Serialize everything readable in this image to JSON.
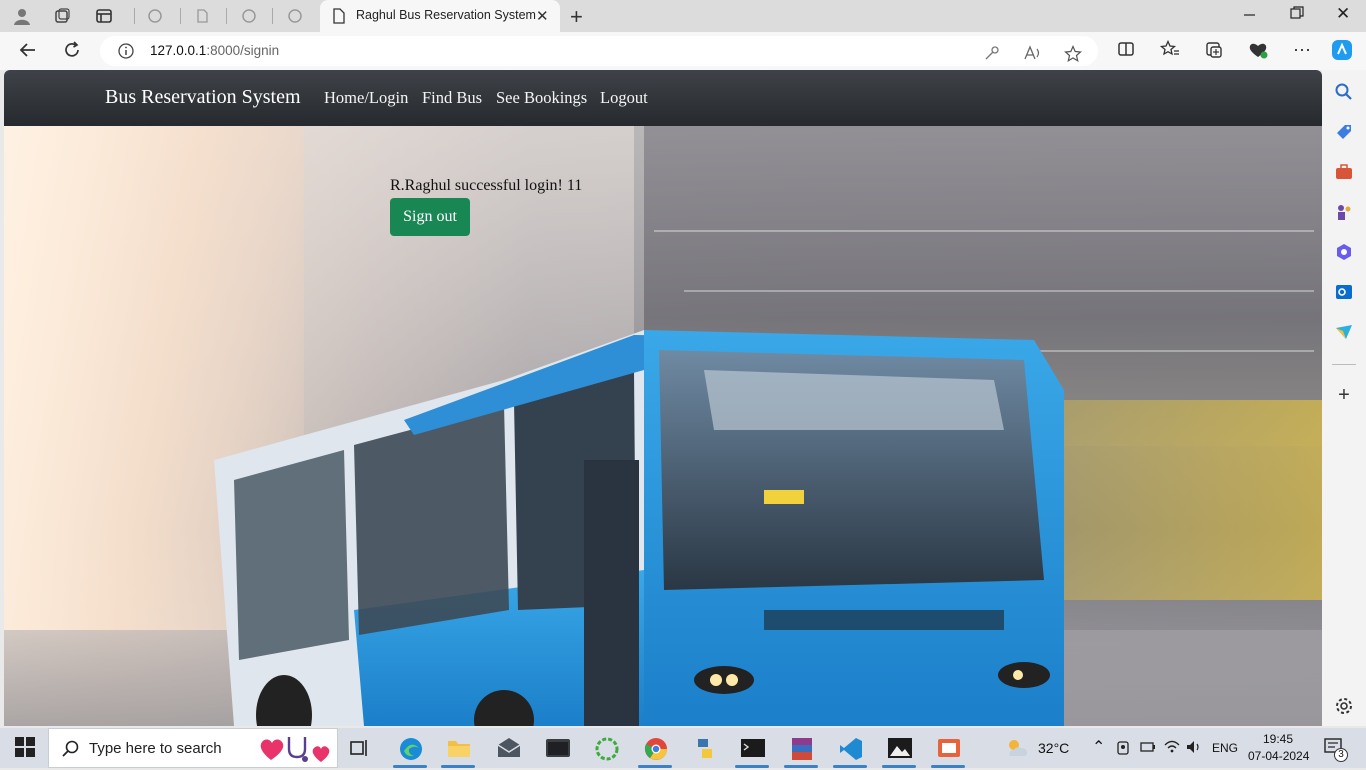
{
  "browser": {
    "active_tab_title": "Raghul Bus Reservation System",
    "url_host": "127.0.0.1",
    "url_path": ":8000/signin"
  },
  "page": {
    "brand": "Bus Reservation System",
    "nav": [
      {
        "label": "Home/Login"
      },
      {
        "label": "Find Bus"
      },
      {
        "label": "See Bookings"
      },
      {
        "label": "Logout"
      }
    ],
    "login_message": "R.Raghul successful login! 11",
    "signout_label": "Sign out",
    "accent_color": "#198754",
    "navbar_color": "#2f3236"
  },
  "taskbar": {
    "search_placeholder": "Type here to search",
    "weather": "32°C",
    "language": "ENG",
    "time": "19:45",
    "date": "07-04-2024",
    "notification_count": "3"
  }
}
